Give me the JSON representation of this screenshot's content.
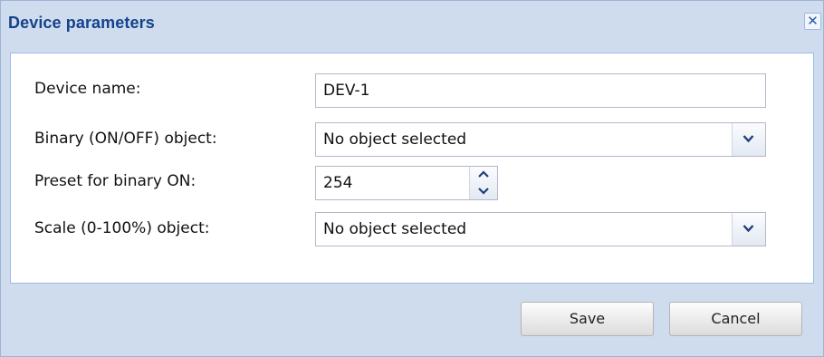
{
  "dialog": {
    "title": "Device parameters",
    "close_icon": "close-icon",
    "accent_color": "#15428b",
    "header_bg": "#cfdcee"
  },
  "form": {
    "device_name": {
      "label": "Device name:",
      "value": "DEV-1"
    },
    "binary_object": {
      "label": "Binary (ON/OFF) object:",
      "value": "No object selected",
      "icon": "chevron-down-icon"
    },
    "preset_binary_on": {
      "label": "Preset for binary ON:",
      "value": "254",
      "icons": [
        "spinner-up-icon",
        "spinner-down-icon"
      ]
    },
    "scale_object": {
      "label": "Scale (0-100%) object:",
      "value": "No object selected",
      "icon": "chevron-down-icon"
    }
  },
  "buttons": {
    "save_label": "Save",
    "cancel_label": "Cancel"
  }
}
